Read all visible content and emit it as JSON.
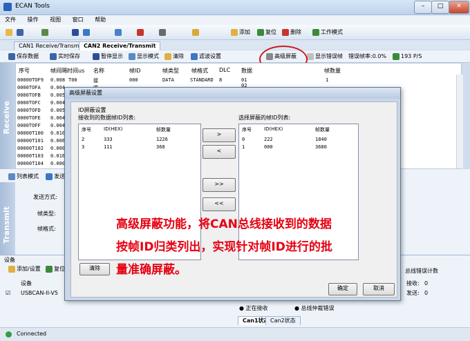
{
  "window": {
    "title": "ECAN Tools",
    "btns": [
      "–",
      "□",
      "✕"
    ]
  },
  "menu": [
    "文件",
    "操作",
    "视图",
    "窗口",
    "帮助"
  ],
  "toolbar": {
    "add": "添加",
    "reset": "复位",
    "delete": "删除",
    "work_mode": "工作模式"
  },
  "tabs": [
    "CAN1 Receive/Transmit",
    "CAN2 Receive/Transmit"
  ],
  "subtool": {
    "save": "保存数据",
    "realtime": "实时保存",
    "pause": "暂停显示",
    "display": "显示模式",
    "clear": "清除",
    "filter": "滤波设置",
    "adv_mask": "高级屏蔽",
    "err_show": "显示错误帧",
    "err_rate": "错误帧率:0.0%",
    "rate": "193 P/S"
  },
  "grid": {
    "side_label": "Receive",
    "headers": [
      "序号",
      "帧间隔时间us",
      "名称",
      "帧ID",
      "帧类型",
      "帧格式",
      "DLC",
      "数据",
      "帧数量"
    ],
    "first_row": [
      "00000TOF9",
      "0.008",
      "T00",
      "接收",
      "000",
      "DATA",
      "STANDARD",
      "8",
      "01 02 03 04 05 06 07 08",
      "1"
    ],
    "rows": [
      [
        "0000TOFA",
        "0.004"
      ],
      [
        "0000TOFB",
        "0.005"
      ],
      [
        "0000TOFC",
        "0.004"
      ],
      [
        "0000TOFD",
        "0.005"
      ],
      [
        "0000TOFE",
        "0.004"
      ],
      [
        "0000TOFF",
        "0.004"
      ],
      [
        "00000T100",
        "0.010"
      ],
      [
        "00000T101",
        "0.006"
      ],
      [
        "00000T102",
        "0.000"
      ],
      [
        "00000T103",
        "0.016"
      ],
      [
        "00000T104",
        "0.000"
      ]
    ]
  },
  "lower": {
    "list_mode": "列表模式",
    "send": "发送",
    "send_mode": "发送方式:",
    "frame_type": "帧类型:",
    "frame_format": "帧格式:",
    "side_label": "Transmit"
  },
  "device": {
    "title": "设备",
    "add_set": "添加/设置",
    "reset": "复位",
    "col": "设备",
    "item": "USBCAN-II-V5",
    "err_title": "总线错误计数",
    "recv": "接收:",
    "recv_val": "0",
    "send": "发送:",
    "send_val": "0",
    "status1": "正在接收",
    "status2": "总线仲裁错误",
    "tab1": "Can1状态",
    "tab2": "Can2状态"
  },
  "status": {
    "text": "Connected"
  },
  "dialog": {
    "title": "高级屏蔽设置",
    "group": "ID屏蔽设置",
    "left_label": "接收到的数据帧ID列表:",
    "right_label": "选择屏蔽的帧ID列表:",
    "cols": [
      "序号",
      "ID(HEX)",
      "帧数量"
    ],
    "left_rows": [
      [
        "2",
        "333",
        "1226"
      ],
      [
        "3",
        "111",
        "368"
      ]
    ],
    "right_rows": [
      [
        "0",
        "222",
        "1840"
      ],
      [
        "1",
        "000",
        "3680"
      ]
    ],
    "btn_right": ">",
    "btn_left": "<",
    "btn_all_right": ">>",
    "btn_all_left": "<<",
    "clear": "清除",
    "ok": "确定",
    "cancel": "取消"
  },
  "annotation": {
    "line1": "高级屏蔽功能，将CAN总线接收到的数据",
    "line2": "按帧ID归类列出，实现针对帧ID进行的批",
    "line3": "量准确屏蔽。"
  }
}
